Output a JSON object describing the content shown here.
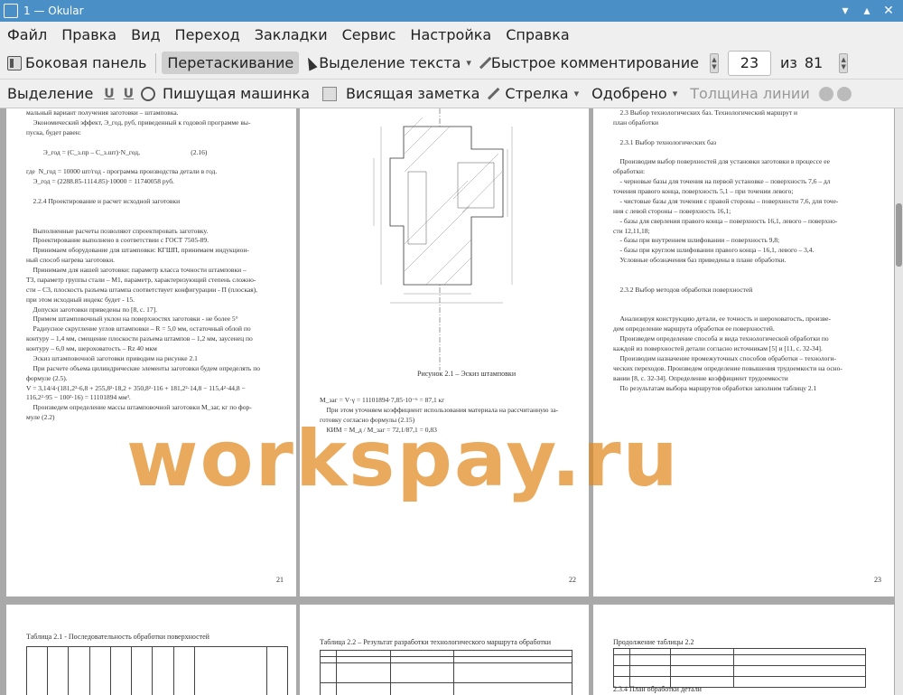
{
  "window": {
    "title": "1 — Okular"
  },
  "menu": [
    "Файл",
    "Правка",
    "Вид",
    "Переход",
    "Закладки",
    "Сервис",
    "Настройка",
    "Справка"
  ],
  "toolbar": {
    "sidebar": "Боковая панель",
    "drag": "Перетаскивание",
    "text_select": "Выделение текста",
    "quick_comment": "Быстрое комментирование",
    "page_current": "23",
    "page_of": "из",
    "page_total": "81"
  },
  "annot_toolbar": {
    "highlight": "Выделение",
    "typewriter": "Пишущая машинка",
    "note": "Висящая заметка",
    "arrow": "Стрелка",
    "approved": "Одобрено",
    "line_width": "Толщина линии"
  },
  "pages": {
    "p1": {
      "number": "21",
      "text": "мальный вариант получения заготовки – штамповка.\n    Экономический эффект, Э_год, руб, приведенный к годовой программе вы-\nпуска, будет равен:\n\n          Э_год = (С_з.пр – С_з.шт)·N_год,                              (2.16)\n\nгде  N_год = 10000 шт/год - программа производства детали в год.\n    Э_год = (2288.85-1114.85)·10000 = 11740058 руб.\n\n    2.2.4 Проектирование и расчет исходной заготовки\n\n\n    Выполненные расчеты позволяют спроектировать заготовку.\n    Проектирование выполнено в соответствии с ГОСТ 7505-89.\n    Принимаем оборудование для штамповки: КГШП, принимаем индукцион-\nный способ нагрева заготовки.\n    Принимаем для нашей заготовки: параметр класса точности штамповки –\nТ3, параметр группы стали – М1, параметр, характеризующий степень сложно-\nсти – С3, плоскость разъема штампа соответствует конфигурации - П (плоская),\nпри этом исходный индекс будет - 15.\n    Допуски заготовки приведены по [8, с. 17].\n    Примем штамповочный уклон на поверхностях заготовки - не более 5°\n    Радиусное скругление углов штамповки – R = 5,0 мм, остаточный облой по\nконтуру – 1,4 мм, смещение плоскости разъема штампов – 1,2 мм, заусенец по\nконтуру – 6,0 мм, шероховатость – Rz 40 мкм\n    Эскиз штамповочной заготовки приводим на рисунке 2.1\n    При расчете объема цилиндрические элементы заготовки будем определять по\nформуле (2.5).\nV = 3,14/4·(181,2²·6,8 + 255,8²·18,2 + 350,8²·116 + 181,2²·14,8 − 115,4²·44,8 −\n116,2²·95 − 100²·16) = 11101894 мм³.\n    Произведем определение массы штамповочной заготовки M_заг, кг по фор-\nмуле (2.2)"
    },
    "p2": {
      "number": "22",
      "caption": "Рисунок 2.1 – Эскиз штамповки",
      "text": "M_заг = V·γ = 11101894·7,85·10⁻⁶ = 87,1 кг\n    При этом уточняем коэффициент использования материала на рассчитанную за-\nготовку согласно формулы (2.15)\n    КИМ = M_д / M_заг = 72,1/87,1 = 0,83"
    },
    "p3": {
      "number": "23",
      "text": "    2.3 Выбор технологических баз. Технологический маршрут и\nплан обработки\n\n    2.3.1 Выбор технологических баз\n\n    Производим выбор поверхностей для установки заготовки в процессе ее\nобработки:\n    - черновые базы для точения на первой установке – поверхность 7,6 – дл\nточения правого конца, поверхность 5,1 – при точении левого;\n    - чистовые базы для точения с правой стороны – поверхности 7,6, для точе-\nния с левой стороны – поверхность 16,1;\n    - базы для сверления правого конца – поверхность 16,1, левого – поверхно-\nсти 12,11,18;\n    - базы при внутреннем шлифовании – поверхность 9,8;\n    - базы при круглом шлифовании правого конца – 16,1, левого – 3,4.\n    Условные обозначения баз приведены в плане обработки.\n\n\n    2.3.2 Выбор методов обработки поверхностей\n\n\n    Анализируя конструкцию детали, ее точность и шероховатость, произве-\nдем определение маршрута обработки ее поверхностей.\n    Произведем определение способа и вида технологической обработки по\nкаждой из поверхностей детали согласно источникам [5] и [11, с. 32-34].\n    Производим назначение промежуточных способов обработки – технологи-\nческих переходов. Произведем определение повышения трудоемкости на осно-\nвании [8, с. 32-34]. Определение коэффициент трудоемкости\n    По результатам выбора маршрутов обработки заполним таблицу 2.1"
    },
    "p4": {
      "title": "Таблица 2.1 - Последовательность обработки поверхностей"
    },
    "p5": {
      "title": "Таблица 2.2 – Результат разработки технологического маршрута обработки"
    },
    "p6": {
      "title": "Продолжение таблицы 2.2",
      "footer": "2.3.4 План обработки детали"
    }
  },
  "watermark": "workspay.ru"
}
